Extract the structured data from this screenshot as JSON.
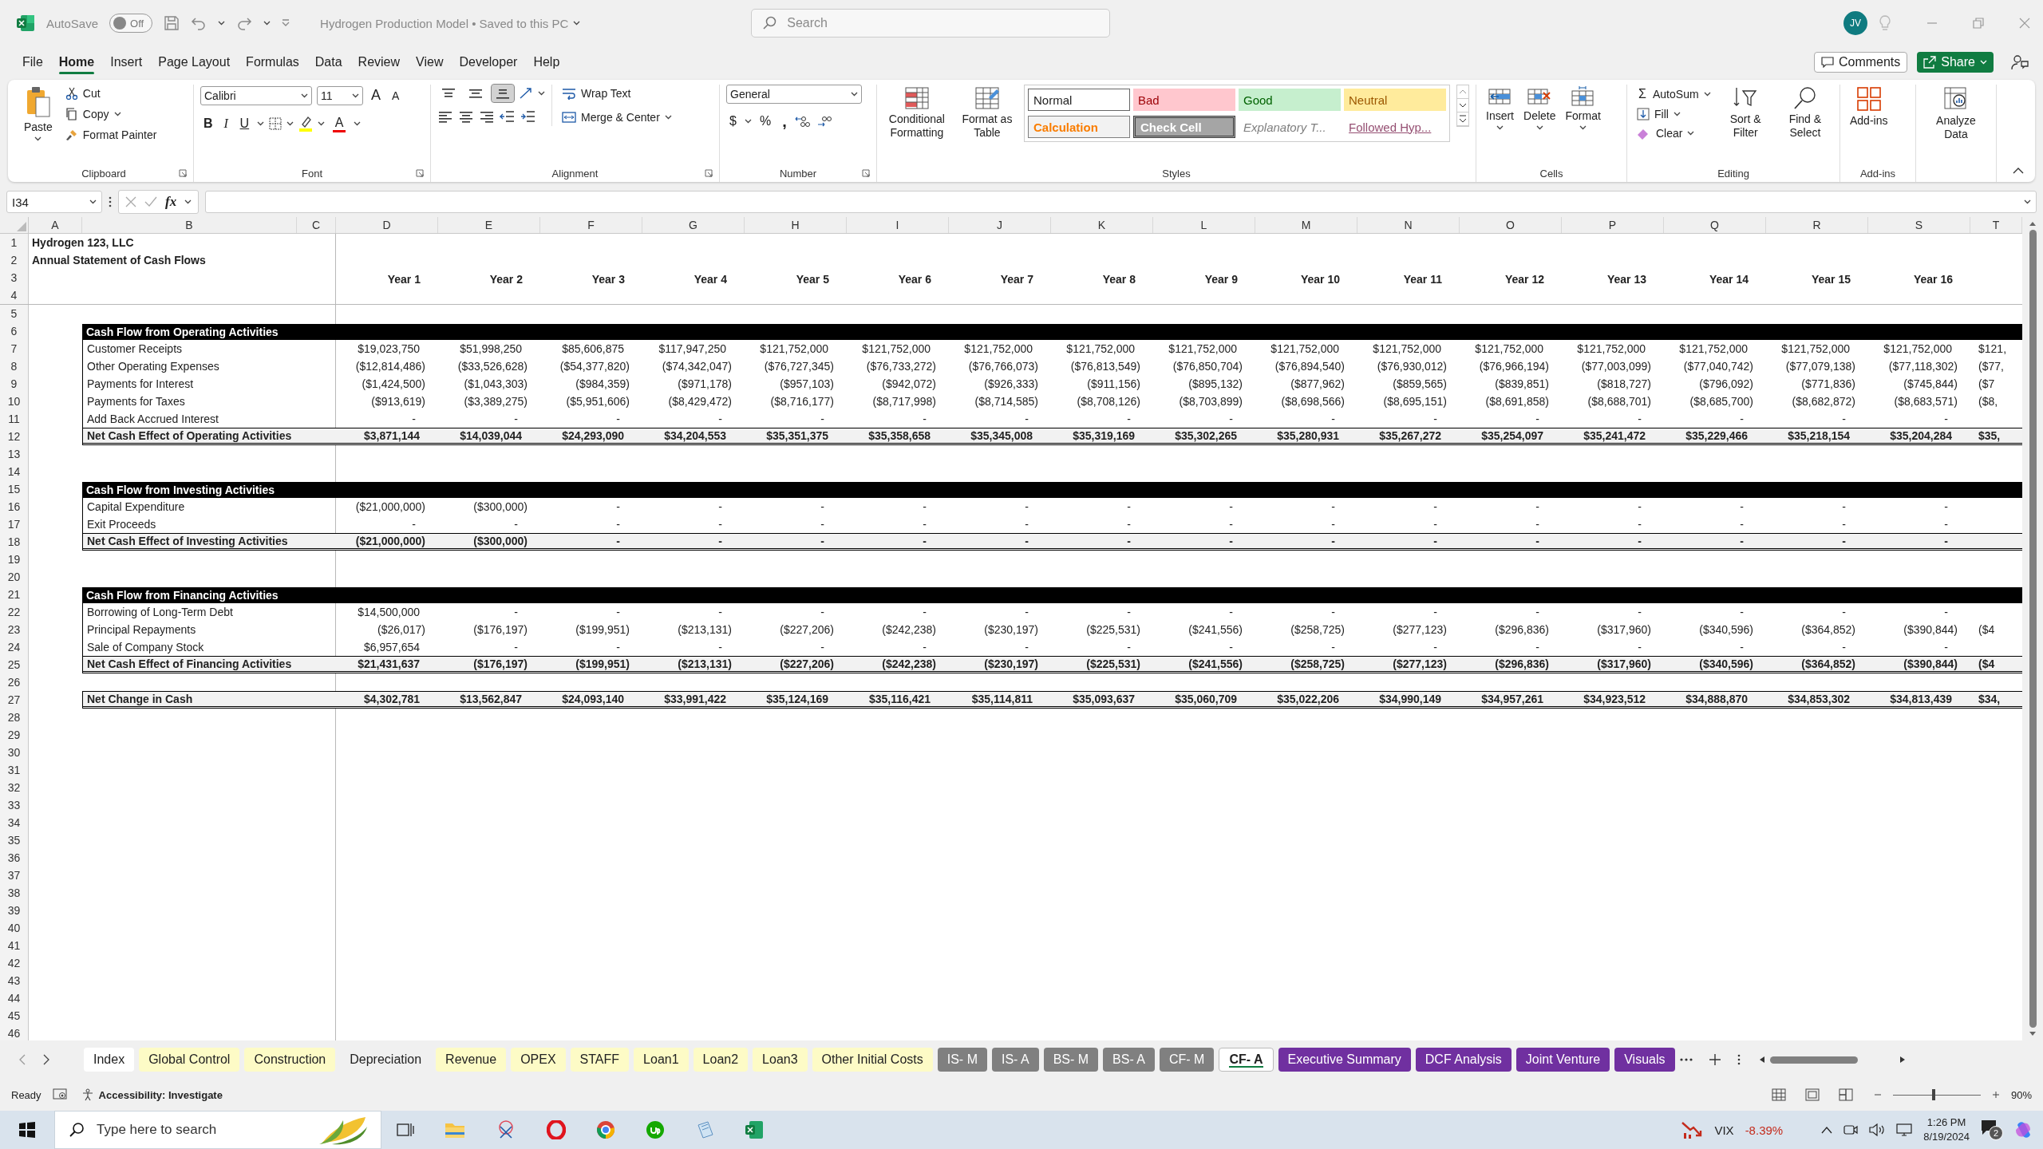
{
  "title_bar": {
    "autosave": {
      "label": "AutoSave",
      "on": false,
      "state": "Off"
    },
    "document": "Hydrogen Production Model • Saved to this PC",
    "search": {
      "placeholder": "Search"
    },
    "avatar": "JV"
  },
  "menu": [
    {
      "label": "File",
      "selected": false
    },
    {
      "label": "Home",
      "selected": true
    },
    {
      "label": "Insert",
      "selected": false
    },
    {
      "label": "Page Layout",
      "selected": false
    },
    {
      "label": "Formulas",
      "selected": false
    },
    {
      "label": "Data",
      "selected": false
    },
    {
      "label": "Review",
      "selected": false
    },
    {
      "label": "View",
      "selected": false
    },
    {
      "label": "Developer",
      "selected": false
    },
    {
      "label": "Help",
      "selected": false
    }
  ],
  "actions": {
    "comments": "Comments",
    "share": "Share"
  },
  "ribbon": {
    "clipboard": {
      "label": "Clipboard",
      "paste": "Paste",
      "cut": "Cut",
      "copy": "Copy",
      "format_painter": "Format Painter"
    },
    "font": {
      "label": "Font",
      "family": "Calibri",
      "size": "11",
      "grow": "A",
      "shrink": "A",
      "bold": "B",
      "italic": "I",
      "underline": "U",
      "font_color": "A"
    },
    "alignment": {
      "label": "Alignment",
      "vertical": [
        {
          "selected": false
        },
        {
          "selected": false
        },
        {
          "selected": true
        }
      ],
      "wrap_text": "Wrap Text",
      "merge_center": "Merge & Center"
    },
    "number": {
      "label": "Number",
      "format": "General",
      "currency": "$",
      "percent": "%",
      "comma": ","
    },
    "styles": {
      "label": "Styles",
      "conditional": "Conditional Formatting",
      "format_table": "Format as Table",
      "cells": [
        {
          "label": "Normal",
          "kind": "normal"
        },
        {
          "label": "Bad",
          "kind": "bad"
        },
        {
          "label": "Good",
          "kind": "good"
        },
        {
          "label": "Neutral",
          "kind": "neutral"
        },
        {
          "label": "Calculation",
          "kind": "calculation"
        },
        {
          "label": "Check Cell",
          "kind": "check"
        },
        {
          "label": "Explanatory T...",
          "kind": "explanatory"
        },
        {
          "label": "Followed Hyp...",
          "kind": "hyperlink"
        }
      ]
    },
    "cells": {
      "label": "Cells",
      "buttons": [
        {
          "label": "Insert",
          "kind": "insert"
        },
        {
          "label": "Delete",
          "kind": "delete"
        },
        {
          "label": "Format",
          "kind": "format"
        }
      ]
    },
    "editing": {
      "label": "Editing",
      "autosum_symbol": "Σ",
      "autosum": "AutoSum",
      "fill": "Fill",
      "clear": "Clear",
      "sort_filter": "Sort & Filter",
      "find_select": "Find & Select"
    },
    "addins": {
      "label": "Add-ins",
      "button": "Add-ins"
    },
    "analyze": {
      "button": "Analyze Data"
    }
  },
  "formula_bar": {
    "name_box": "I34",
    "fx": "fx"
  },
  "sheet": {
    "columns": [
      "A",
      "B",
      "C",
      "D",
      "E",
      "F",
      "G",
      "H",
      "I",
      "J",
      "K",
      "L",
      "M",
      "N",
      "O",
      "P",
      "Q",
      "R",
      "S",
      "T"
    ],
    "rows": [
      {
        "n": "1",
        "kind": "title",
        "label": "Hydrogen 123, LLC"
      },
      {
        "n": "2",
        "kind": "title",
        "label": "Annual Statement of Cash Flows"
      },
      {
        "n": "3",
        "kind": "years",
        "values": [
          "Year 1",
          "Year 2",
          "Year 3",
          "Year 4",
          "Year 5",
          "Year 6",
          "Year 7",
          "Year 8",
          "Year 9",
          "Year 10",
          "Year 11",
          "Year 12",
          "Year 13",
          "Year 14",
          "Year 15",
          "Year 16"
        ]
      },
      {
        "n": "4",
        "kind": "blank"
      },
      {
        "n": "5",
        "kind": "blank"
      },
      {
        "n": "6",
        "kind": "section",
        "label": "Cash Flow from Operating Activities"
      },
      {
        "n": "7",
        "kind": "item",
        "label": "Customer Receipts",
        "values": [
          "$19,023,750",
          "$51,998,250",
          "$85,606,875",
          "$117,947,250",
          "$121,752,000",
          "$121,752,000",
          "$121,752,000",
          "$121,752,000",
          "$121,752,000",
          "$121,752,000",
          "$121,752,000",
          "$121,752,000",
          "$121,752,000",
          "$121,752,000",
          "$121,752,000",
          "$121,752,000"
        ],
        "cut": "$121,"
      },
      {
        "n": "8",
        "kind": "item",
        "label": "Other Operating Expenses",
        "values": [
          "($12,814,486)",
          "($33,526,628)",
          "($54,377,820)",
          "($74,342,047)",
          "($76,727,345)",
          "($76,733,272)",
          "($76,766,073)",
          "($76,813,549)",
          "($76,850,704)",
          "($76,894,540)",
          "($76,930,012)",
          "($76,966,194)",
          "($77,003,099)",
          "($77,040,742)",
          "($77,079,138)",
          "($77,118,302)"
        ],
        "cut": "($77,"
      },
      {
        "n": "9",
        "kind": "item",
        "label": "Payments for Interest",
        "values": [
          "($1,424,500)",
          "($1,043,303)",
          "($984,359)",
          "($971,178)",
          "($957,103)",
          "($942,072)",
          "($926,333)",
          "($911,156)",
          "($895,132)",
          "($877,962)",
          "($859,565)",
          "($839,851)",
          "($818,727)",
          "($796,092)",
          "($771,836)",
          "($745,844)"
        ],
        "cut": "($7"
      },
      {
        "n": "10",
        "kind": "item",
        "label": "Payments for Taxes",
        "values": [
          "($913,619)",
          "($3,389,275)",
          "($5,951,606)",
          "($8,429,472)",
          "($8,716,177)",
          "($8,717,998)",
          "($8,714,585)",
          "($8,708,126)",
          "($8,703,899)",
          "($8,698,566)",
          "($8,695,151)",
          "($8,691,858)",
          "($8,688,701)",
          "($8,685,700)",
          "($8,682,872)",
          "($8,683,571)"
        ],
        "cut": "($8,"
      },
      {
        "n": "11",
        "kind": "item",
        "label": "Add Back Accrued Interest",
        "values": [
          "-",
          "-",
          "-",
          "-",
          "-",
          "-",
          "-",
          "-",
          "-",
          "-",
          "-",
          "-",
          "-",
          "-",
          "-",
          "-"
        ]
      },
      {
        "n": "12",
        "kind": "total",
        "label": "Net Cash Effect of Operating Activities",
        "values": [
          "$3,871,144",
          "$14,039,044",
          "$24,293,090",
          "$34,204,553",
          "$35,351,375",
          "$35,358,658",
          "$35,345,008",
          "$35,319,169",
          "$35,302,265",
          "$35,280,931",
          "$35,267,272",
          "$35,254,097",
          "$35,241,472",
          "$35,229,466",
          "$35,218,154",
          "$35,204,284"
        ],
        "cut": "$35,"
      },
      {
        "n": "13",
        "kind": "blank"
      },
      {
        "n": "14",
        "kind": "blank"
      },
      {
        "n": "15",
        "kind": "section",
        "label": "Cash Flow from Investing Activities"
      },
      {
        "n": "16",
        "kind": "item",
        "label": "Capital Expenditure",
        "values": [
          "($21,000,000)",
          "($300,000)",
          "-",
          "-",
          "-",
          "-",
          "-",
          "-",
          "-",
          "-",
          "-",
          "-",
          "-",
          "-",
          "-",
          "-"
        ]
      },
      {
        "n": "17",
        "kind": "item",
        "label": "Exit Proceeds",
        "values": [
          "-",
          "-",
          "-",
          "-",
          "-",
          "-",
          "-",
          "-",
          "-",
          "-",
          "-",
          "-",
          "-",
          "-",
          "-",
          "-"
        ]
      },
      {
        "n": "18",
        "kind": "total",
        "label": "Net Cash Effect of Investing Activities",
        "values": [
          "($21,000,000)",
          "($300,000)",
          "-",
          "-",
          "-",
          "-",
          "-",
          "-",
          "-",
          "-",
          "-",
          "-",
          "-",
          "-",
          "-",
          "-"
        ]
      },
      {
        "n": "19",
        "kind": "blank"
      },
      {
        "n": "20",
        "kind": "blank"
      },
      {
        "n": "21",
        "kind": "section",
        "label": "Cash Flow from Financing Activities"
      },
      {
        "n": "22",
        "kind": "item",
        "label": "Borrowing of Long-Term Debt",
        "values": [
          "$14,500,000",
          "-",
          "-",
          "-",
          "-",
          "-",
          "-",
          "-",
          "-",
          "-",
          "-",
          "-",
          "-",
          "-",
          "-",
          "-"
        ]
      },
      {
        "n": "23",
        "kind": "item",
        "label": "Principal Repayments",
        "values": [
          "($26,017)",
          "($176,197)",
          "($199,951)",
          "($213,131)",
          "($227,206)",
          "($242,238)",
          "($230,197)",
          "($225,531)",
          "($241,556)",
          "($258,725)",
          "($277,123)",
          "($296,836)",
          "($317,960)",
          "($340,596)",
          "($364,852)",
          "($390,844)"
        ],
        "cut": "($4"
      },
      {
        "n": "24",
        "kind": "item",
        "label": "Sale of Company Stock",
        "values": [
          "$6,957,654",
          "-",
          "-",
          "-",
          "-",
          "-",
          "-",
          "-",
          "-",
          "-",
          "-",
          "-",
          "-",
          "-",
          "-",
          "-"
        ]
      },
      {
        "n": "25",
        "kind": "total",
        "label": "Net Cash Effect of Financing Activities",
        "values": [
          "$21,431,637",
          "($176,197)",
          "($199,951)",
          "($213,131)",
          "($227,206)",
          "($242,238)",
          "($230,197)",
          "($225,531)",
          "($241,556)",
          "($258,725)",
          "($277,123)",
          "($296,836)",
          "($317,960)",
          "($340,596)",
          "($364,852)",
          "($390,844)"
        ],
        "cut": "($4"
      },
      {
        "n": "26",
        "kind": "blank"
      },
      {
        "n": "27",
        "kind": "grand",
        "label": "Net Change in Cash",
        "values": [
          "$4,302,781",
          "$13,562,847",
          "$24,093,140",
          "$33,991,422",
          "$35,124,169",
          "$35,116,421",
          "$35,114,811",
          "$35,093,637",
          "$35,060,709",
          "$35,022,206",
          "$34,990,149",
          "$34,957,261",
          "$34,923,512",
          "$34,888,870",
          "$34,853,302",
          "$34,813,439"
        ],
        "cut": "$34,"
      },
      {
        "n": "28",
        "kind": "blank"
      },
      {
        "n": "29",
        "kind": "blank"
      },
      {
        "n": "30",
        "kind": "blank"
      },
      {
        "n": "31",
        "kind": "blank"
      },
      {
        "n": "32",
        "kind": "blank"
      },
      {
        "n": "33",
        "kind": "blank"
      },
      {
        "n": "34",
        "kind": "blank"
      },
      {
        "n": "35",
        "kind": "blank"
      },
      {
        "n": "36",
        "kind": "blank"
      },
      {
        "n": "37",
        "kind": "blank"
      },
      {
        "n": "38",
        "kind": "blank"
      },
      {
        "n": "39",
        "kind": "blank"
      },
      {
        "n": "40",
        "kind": "blank"
      },
      {
        "n": "41",
        "kind": "blank"
      },
      {
        "n": "42",
        "kind": "blank"
      },
      {
        "n": "43",
        "kind": "blank"
      },
      {
        "n": "44",
        "kind": "blank"
      },
      {
        "n": "45",
        "kind": "blank"
      },
      {
        "n": "46",
        "kind": "blank"
      }
    ]
  },
  "sheet_tabs": [
    {
      "label": "Index",
      "color": "#ffffff",
      "selected": false
    },
    {
      "label": "Global Control",
      "color": "#fdfbc6",
      "selected": false
    },
    {
      "label": "Construction",
      "color": "#fdfbc6",
      "selected": false
    },
    {
      "label": "Depreciation",
      "color": "#f0f0f0",
      "selected": false
    },
    {
      "label": "Revenue",
      "color": "#fdfbc6",
      "selected": false
    },
    {
      "label": "OPEX",
      "color": "#fdfbc6",
      "selected": false
    },
    {
      "label": "STAFF",
      "color": "#fdfbc6",
      "selected": false
    },
    {
      "label": "Loan1",
      "color": "#fdfbc6",
      "selected": false
    },
    {
      "label": "Loan2",
      "color": "#fdfbc6",
      "selected": false
    },
    {
      "label": "Loan3",
      "color": "#fdfbc6",
      "selected": false
    },
    {
      "label": "Other Initial Costs",
      "color": "#fdfbc6",
      "selected": false
    },
    {
      "label": "IS- M",
      "color": "#808080",
      "selected": false
    },
    {
      "label": "IS- A",
      "color": "#808080",
      "selected": false
    },
    {
      "label": "BS- M",
      "color": "#808080",
      "selected": false
    },
    {
      "label": "BS- A",
      "color": "#808080",
      "selected": false
    },
    {
      "label": "CF- M",
      "color": "#808080",
      "selected": false
    },
    {
      "label": "CF- A",
      "color": "#ffffff",
      "selected": true
    },
    {
      "label": "Executive Summary",
      "color": "#7030a0",
      "selected": false
    },
    {
      "label": "DCF Analysis",
      "color": "#7030a0",
      "selected": false
    },
    {
      "label": "Joint Venture",
      "color": "#7030a0",
      "selected": false
    },
    {
      "label": "Visuals",
      "color": "#7030a0",
      "selected": false
    }
  ],
  "status_bar": {
    "ready": "Ready",
    "accessibility": "Accessibility: Investigate",
    "zoom_slider": {
      "level": 0.45
    },
    "zoom": "90%"
  },
  "taskbar": {
    "search": {
      "placeholder": "Type here to search"
    },
    "ticker": "VIX",
    "change": "-8.39%",
    "time": "1:26 PM",
    "date": "8/19/2024",
    "notifications": "2"
  }
}
